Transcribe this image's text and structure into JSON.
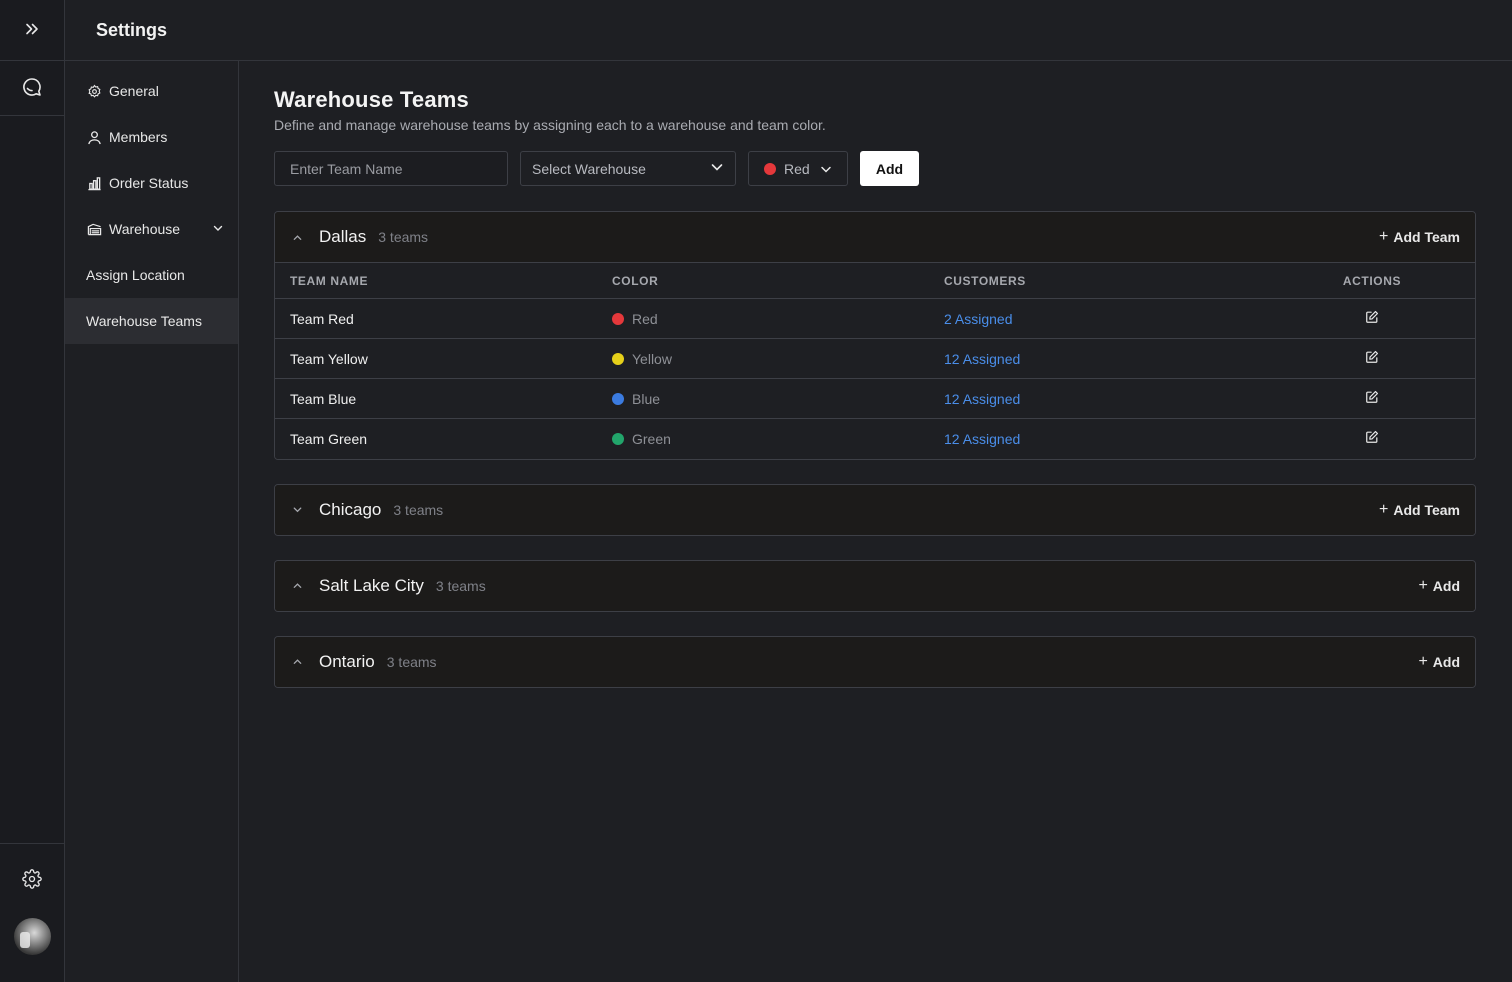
{
  "header": {
    "title": "Settings"
  },
  "rail": {
    "expand_icon": "double-chevron-right-icon",
    "chat_icon": "chat-icon",
    "settings_icon": "gear-icon",
    "avatar": "user-avatar"
  },
  "subnav": {
    "items": [
      {
        "label": "General",
        "icon": "gear-icon"
      },
      {
        "label": "Members",
        "icon": "user-icon"
      },
      {
        "label": "Order Status",
        "icon": "bar-chart-icon"
      },
      {
        "label": "Warehouse",
        "icon": "warehouse-icon",
        "expanded": true
      },
      {
        "label": "Assign Location"
      },
      {
        "label": "Warehouse Teams",
        "active": true
      }
    ]
  },
  "page": {
    "title": "Warehouse Teams",
    "subtitle": "Define and manage warehouse teams by assigning each to a warehouse and team color."
  },
  "form": {
    "team_name_placeholder": "Enter Team Name",
    "warehouse_placeholder": "Select Warehouse",
    "color_value": "Red",
    "color_hex": "#e5383b",
    "add_label": "Add"
  },
  "table_headers": {
    "team_name": "TEAM NAME",
    "color": "COLOR",
    "customers": "CUSTOMERS",
    "actions": "ACTIONS"
  },
  "groups": [
    {
      "name": "Dallas",
      "count": "3 teams",
      "add_label": "Add Team",
      "expanded": true,
      "rows": [
        {
          "team": "Team Red",
          "color": "Red",
          "color_hex": "#e5383b",
          "customers": "2 Assigned"
        },
        {
          "team": "Team Yellow",
          "color": "Yellow",
          "color_hex": "#e6d01a",
          "customers": "12 Assigned"
        },
        {
          "team": "Team Blue",
          "color": "Blue",
          "color_hex": "#3b7be0",
          "customers": "12 Assigned"
        },
        {
          "team": "Team Green",
          "color": "Green",
          "color_hex": "#22a56b",
          "customers": "12 Assigned"
        }
      ]
    },
    {
      "name": "Chicago",
      "count": "3 teams",
      "add_label": "Add Team",
      "expanded": false
    },
    {
      "name": "Salt Lake City",
      "count": "3 teams",
      "add_label": "Add",
      "expanded": false
    },
    {
      "name": "Ontario",
      "count": "3 teams",
      "add_label": "Add",
      "expanded": false
    }
  ]
}
